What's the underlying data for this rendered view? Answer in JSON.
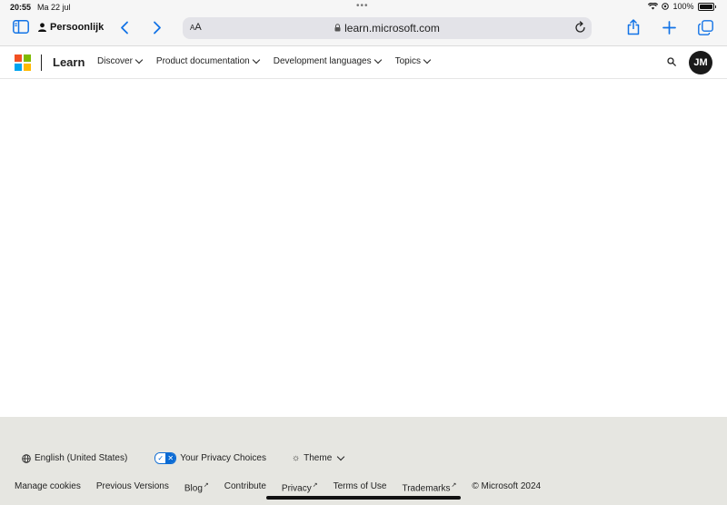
{
  "status_bar": {
    "time": "20:55",
    "date": "Ma 22 jul",
    "battery": "100%"
  },
  "browser": {
    "profile_label": "Persoonlijk",
    "aa_label_small": "A",
    "aa_label_large": "A",
    "url": "learn.microsoft.com"
  },
  "header": {
    "brand": "Learn",
    "nav": [
      {
        "label": "Discover"
      },
      {
        "label": "Product documentation"
      },
      {
        "label": "Development languages"
      },
      {
        "label": "Topics"
      }
    ],
    "avatar_initials": "JM"
  },
  "footer": {
    "language": "English (United States)",
    "privacy_choices": "Your Privacy Choices",
    "theme": "Theme",
    "links": [
      {
        "label": "Manage cookies",
        "external": false
      },
      {
        "label": "Previous Versions",
        "external": false
      },
      {
        "label": "Blog",
        "external": true
      },
      {
        "label": "Contribute",
        "external": false
      },
      {
        "label": "Privacy",
        "external": true
      },
      {
        "label": "Terms of Use",
        "external": false
      },
      {
        "label": "Trademarks",
        "external": true
      },
      {
        "label": "© Microsoft 2024",
        "external": false
      }
    ]
  },
  "colors": {
    "accent": "#1273e6",
    "footer_bg": "#e6e6e1",
    "ms_red": "#f25022",
    "ms_green": "#7fba00",
    "ms_blue": "#00a4ef",
    "ms_yellow": "#ffb900"
  },
  "icons": {
    "sidebar": "sidebar-icon",
    "back": "chevron-left-icon",
    "forward": "chevron-right-icon",
    "lock": "lock-icon",
    "reload": "reload-icon",
    "share": "share-icon",
    "new_tab": "plus-icon",
    "tabs": "tabs-icon",
    "search": "search-icon",
    "globe": "globe-icon",
    "theme": "sun-icon"
  }
}
